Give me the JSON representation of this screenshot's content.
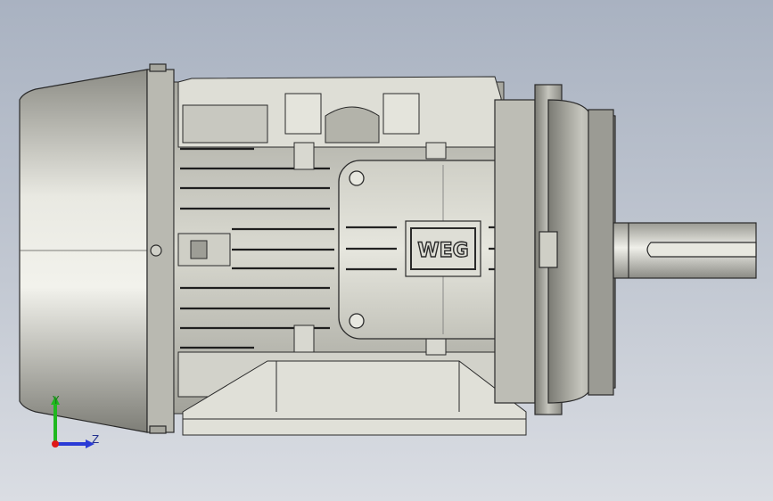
{
  "model": {
    "logo_text": "WEG",
    "colors": {
      "background_top": "#a9b2c1",
      "background_bottom": "#dadde3",
      "metal_light": "#e8e8e0",
      "metal_mid": "#bdbdb3",
      "metal_dark": "#6e6e68",
      "outline": "#2a2a2a"
    }
  },
  "triad": {
    "y_label": "Y",
    "z_label": "Z",
    "y_color": "#1fb81f",
    "z_color": "#2a3bd6",
    "origin_color": "#e01818"
  }
}
